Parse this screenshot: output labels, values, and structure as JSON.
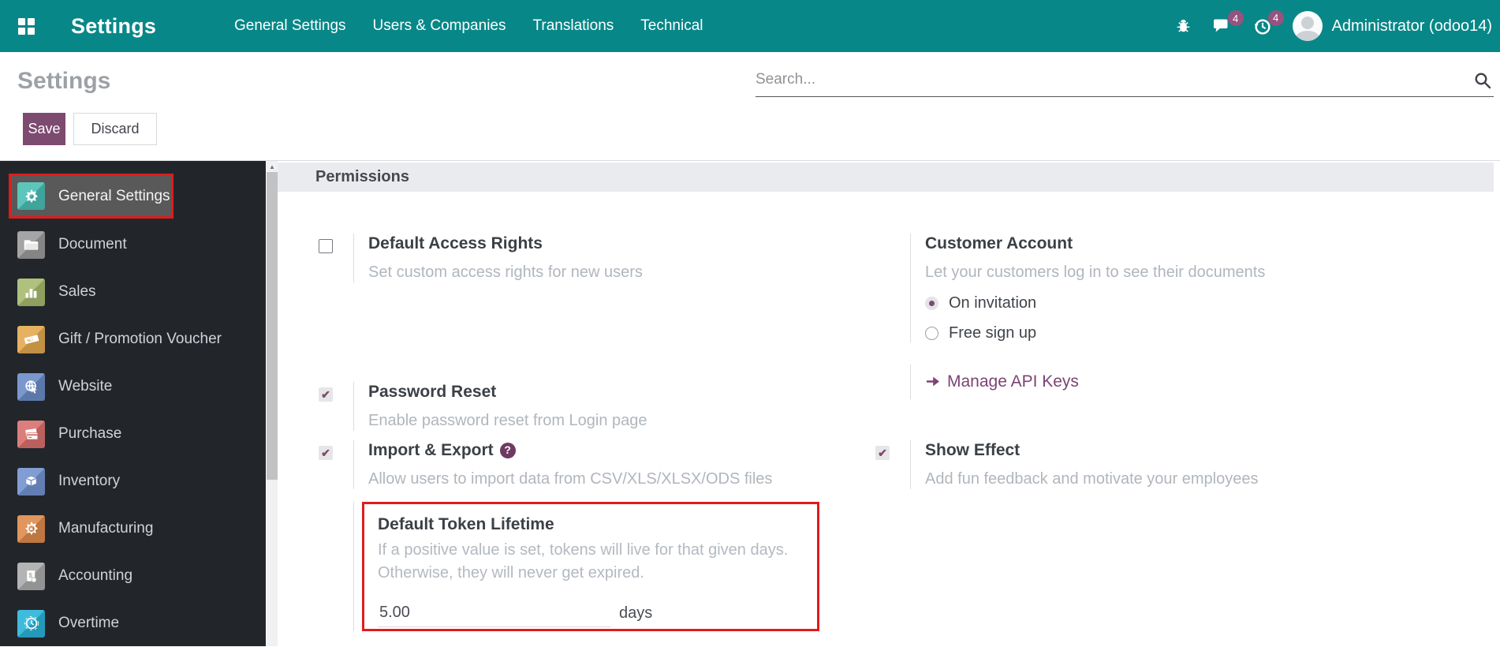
{
  "colors": {
    "nav_teal": "#088788",
    "accent_purple": "#7d4a70",
    "badge_purple": "#95537f",
    "highlight_red": "#e11b1b",
    "sidebar_dark": "#22262b"
  },
  "nav": {
    "brand": "Settings",
    "menu": [
      "General Settings",
      "Users & Companies",
      "Translations",
      "Technical"
    ],
    "message_badge": "4",
    "activity_badge": "4",
    "user": "Administrator (odoo14)"
  },
  "header": {
    "page_title": "Settings",
    "search_placeholder": "Search...",
    "save_label": "Save",
    "discard_label": "Discard"
  },
  "sidebar": {
    "items": [
      {
        "label": "General Settings",
        "color": "#49bfb4",
        "selected": true
      },
      {
        "label": "Document",
        "color": "#9b9b9b",
        "selected": false
      },
      {
        "label": "Sales",
        "color": "#a6ba6d",
        "selected": false
      },
      {
        "label": "Gift / Promotion Voucher",
        "color": "#e3a94f",
        "selected": false
      },
      {
        "label": "Website",
        "color": "#6b8cc7",
        "selected": false
      },
      {
        "label": "Purchase",
        "color": "#d8706c",
        "selected": false
      },
      {
        "label": "Inventory",
        "color": "#7392cf",
        "selected": false
      },
      {
        "label": "Manufacturing",
        "color": "#dd8a4b",
        "selected": false
      },
      {
        "label": "Accounting",
        "color": "#ababab",
        "selected": false
      },
      {
        "label": "Overtime",
        "color": "#29b3d8",
        "selected": false
      }
    ]
  },
  "content": {
    "section_title": "Permissions",
    "default_access_rights": {
      "label": "Default Access Rights",
      "desc": "Set custom access rights for new users",
      "checked": false
    },
    "customer_account": {
      "label": "Customer Account",
      "desc": "Let your customers log in to see their documents",
      "options": [
        {
          "label": "On invitation",
          "selected": true
        },
        {
          "label": "Free sign up",
          "selected": false
        }
      ]
    },
    "password_reset": {
      "label": "Password Reset",
      "desc": "Enable password reset from Login page",
      "checked": true
    },
    "manage_api_keys": {
      "label": "Manage API Keys"
    },
    "import_export": {
      "label": "Import & Export",
      "desc": "Allow users to import data from CSV/XLS/XLSX/ODS files",
      "checked": true
    },
    "show_effect": {
      "label": "Show Effect",
      "desc": "Add fun feedback and motivate your employees",
      "checked": true
    },
    "default_token_lifetime": {
      "label": "Default Token Lifetime",
      "desc_line1": "If a positive value is set, tokens will live for that given days.",
      "desc_line2": "Otherwise, they will never get expired.",
      "value": "5.00",
      "unit": "days"
    }
  }
}
